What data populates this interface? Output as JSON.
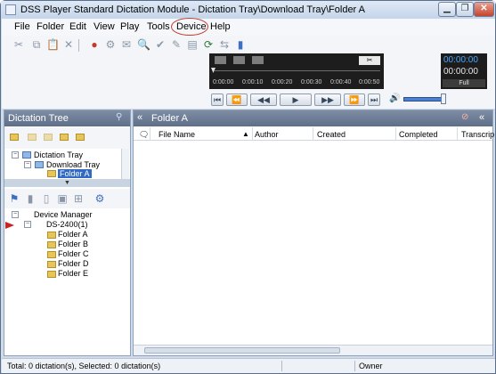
{
  "window": {
    "title": "DSS Player Standard Dictation Module - Dictation Tray\\Download Tray\\Folder A",
    "min": "▁",
    "max": "❐",
    "close": "✕"
  },
  "menu": {
    "items": [
      "File",
      "Folder",
      "Edit",
      "View",
      "Play",
      "Tools",
      "Device",
      "Help"
    ]
  },
  "player": {
    "ticks": [
      "0:00:00",
      "0:00:10",
      "0:00:20",
      "0:00:30",
      "0:00:40",
      "0:00:50"
    ],
    "current_time": "00:00:00",
    "total_time": "00:00:00",
    "mode": "Full",
    "scissors": "✂"
  },
  "dictation_tree": {
    "title": "Dictation Tree",
    "root": "Dictation Tray",
    "child": "Download Tray",
    "selected": "Folder A",
    "device_manager": "Device Manager",
    "device": "DS-2400(1)",
    "folders": [
      {
        "letter": "A",
        "name": "Folder A"
      },
      {
        "letter": "B",
        "name": "Folder B"
      },
      {
        "letter": "C",
        "name": "Folder C"
      },
      {
        "letter": "D",
        "name": "Folder D"
      },
      {
        "letter": "E",
        "name": "Folder E"
      }
    ]
  },
  "list_pane": {
    "title": "Folder A",
    "columns": [
      "File Name",
      "Author",
      "Created",
      "Completed",
      "Transcrip"
    ]
  },
  "status": {
    "summary": "Total: 0 dictation(s), Selected: 0 dictation(s)",
    "owner": "Owner"
  },
  "colors": {
    "highlight": "#c23a2c",
    "selection": "#316ac5"
  }
}
